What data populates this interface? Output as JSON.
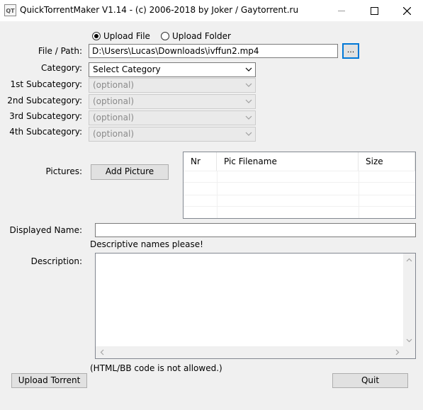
{
  "window": {
    "title": "QuickTorrentMaker V1.14 - (c) 2006-2018 by Joker / Gaytorrent.ru",
    "icon_text": "QT"
  },
  "upload_mode": {
    "file_label": "Upload File",
    "folder_label": "Upload Folder",
    "selected": "file"
  },
  "path": {
    "label": "File / Path:",
    "value": "D:\\Users\\Lucas\\Downloads\\ivffun2.mp4",
    "browse_label": "..."
  },
  "category": {
    "label": "Category:",
    "value": "Select Category"
  },
  "subcategories": [
    {
      "label": "1st Subcategory:",
      "value": "(optional)"
    },
    {
      "label": "2nd Subcategory:",
      "value": "(optional)"
    },
    {
      "label": "3rd Subcategory:",
      "value": "(optional)"
    },
    {
      "label": "4th Subcategory:",
      "value": "(optional)"
    }
  ],
  "pictures": {
    "label": "Pictures:",
    "add_button": "Add Picture",
    "columns": [
      "Nr",
      "Pic Filename",
      "Size"
    ]
  },
  "displayed_name": {
    "label": "Displayed Name:",
    "value": "",
    "hint": "Descriptive names please!"
  },
  "description": {
    "label": "Description:",
    "value": "",
    "hint": "(HTML/BB code is not allowed.)"
  },
  "buttons": {
    "upload": "Upload Torrent",
    "quit": "Quit"
  }
}
